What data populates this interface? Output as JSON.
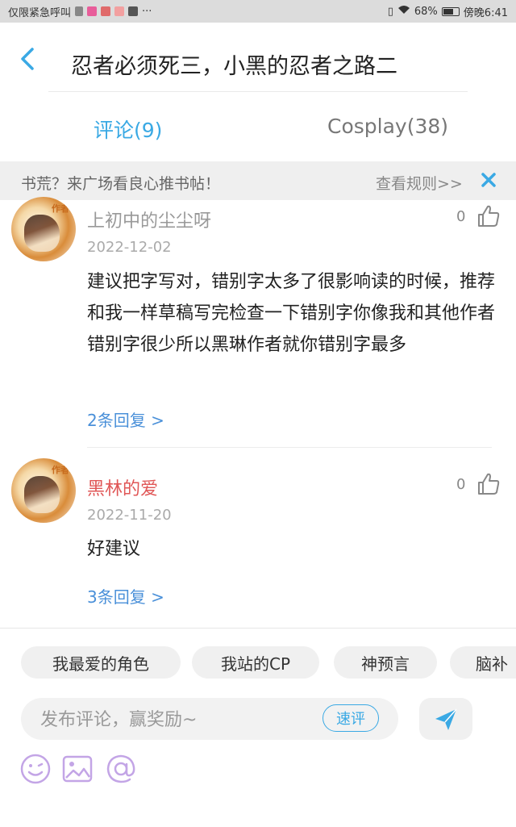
{
  "status_bar": {
    "left_text": "仅限紧急呼叫",
    "more": "···",
    "battery": "68%",
    "time": "傍晚6:41"
  },
  "header": {
    "title": "忍者必须死三，小黑的忍者之路二"
  },
  "tabs": [
    {
      "label": "评论(9)",
      "active": true
    },
    {
      "label": "Cosplay(38)",
      "active": false
    }
  ],
  "banner": {
    "text": "书荒？来广场看良心推书帖！",
    "link": "查看规则>>"
  },
  "comments": [
    {
      "username": "上初中的尘尘呀",
      "username_color": "#999999",
      "date": "2022-12-02",
      "likes": "0",
      "avatar_badge": "作者",
      "text": "建议把字写对，错别字太多了很影响读的时候，推荐和我一样草稿写完检查一下错别字你像我和其他作者错别字很少所以黑琳作者就你错别字最多",
      "replies": "2条回复 >"
    },
    {
      "username": "黑林的爱",
      "username_color": "#e05656",
      "date": "2022-11-20",
      "likes": "0",
      "avatar_badge": "作者",
      "text": "好建议",
      "replies": "3条回复 >"
    }
  ],
  "chips": [
    "我最爱的角色",
    "我站的CP",
    "神预言",
    "脑补"
  ],
  "composer": {
    "placeholder": "发布评论，赢奖励~",
    "quick_label": "速评"
  },
  "colors": {
    "accent": "#3aa9e4",
    "link": "#4a90d9",
    "tool_icon": "#c3a5e6"
  }
}
